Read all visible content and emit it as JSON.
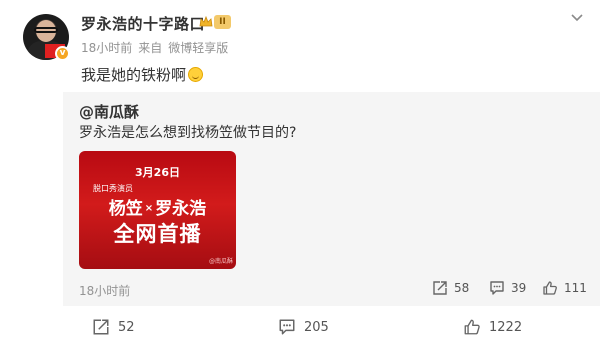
{
  "post": {
    "username": "罗永浩的十字路口",
    "level_badge": "II",
    "time": "18小时前",
    "source_prefix": "来自",
    "source": "微博轻享版",
    "text": "我是她的铁粉啊"
  },
  "repost": {
    "author": "@南瓜酥",
    "text": "罗永浩是怎么想到找杨笠做节目的?",
    "image": {
      "date": "3月26日",
      "subtitle": "脱口秀演员",
      "name_left": "杨笠",
      "times": "×",
      "name_right": "罗永浩",
      "headline": "全网首播",
      "watermark": "@南瓜酥"
    },
    "time": "18小时前",
    "actions": {
      "repost": "58",
      "comment": "39",
      "like": "111"
    }
  },
  "actions": {
    "repost": "52",
    "comment": "205",
    "like": "1222"
  },
  "colors": {
    "accent_red": "#d21b1b",
    "badge_gold": "#f5a623",
    "muted": "#939393"
  },
  "icons": [
    "verified-badge-icon",
    "crown-icon",
    "more-chevron-icon",
    "smile-emoji-icon",
    "repost-icon",
    "comment-icon",
    "like-icon"
  ]
}
